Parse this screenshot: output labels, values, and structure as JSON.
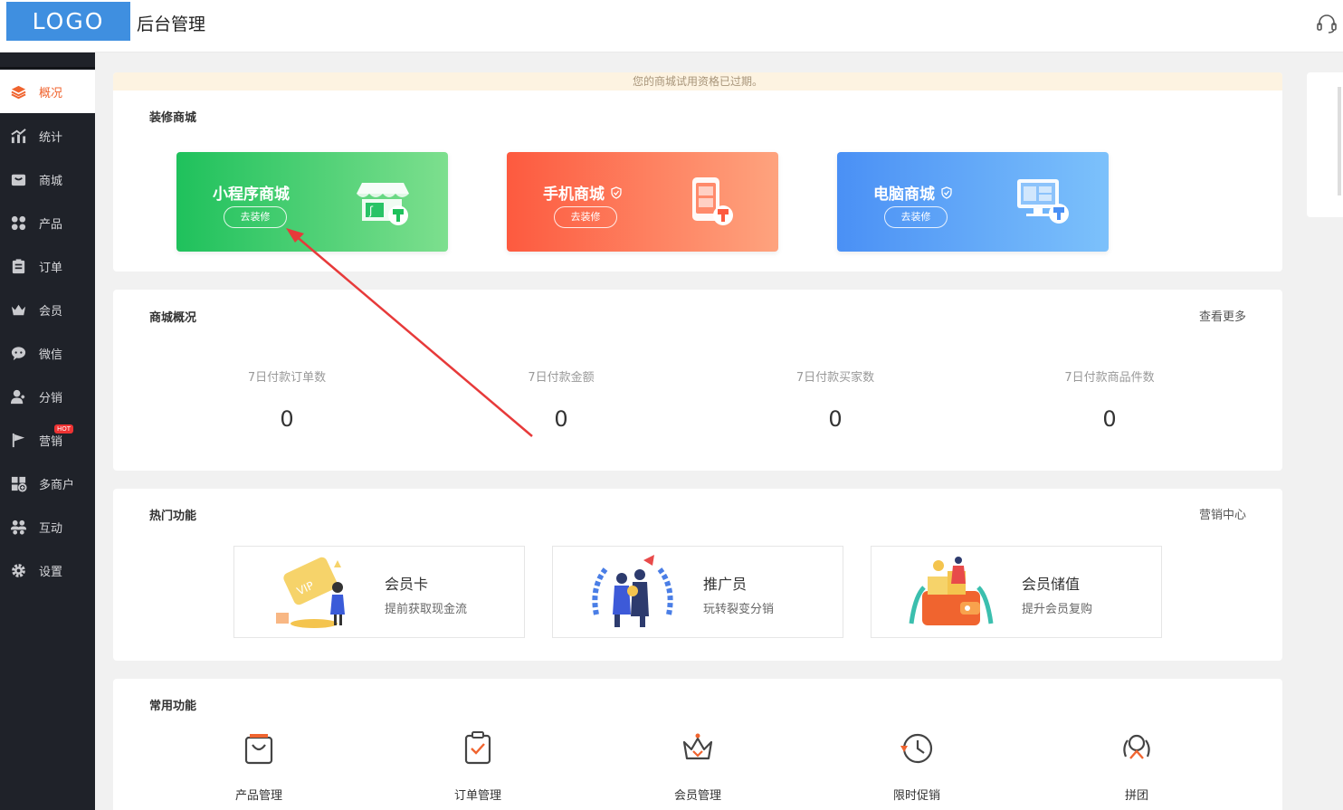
{
  "header": {
    "logo": "LOGO",
    "title": "后台管理"
  },
  "sidebar": {
    "items": [
      {
        "label": "概况",
        "icon": "layers-icon"
      },
      {
        "label": "统计",
        "icon": "chart-icon"
      },
      {
        "label": "商城",
        "icon": "store-icon"
      },
      {
        "label": "产品",
        "icon": "grid-icon"
      },
      {
        "label": "订单",
        "icon": "order-icon"
      },
      {
        "label": "会员",
        "icon": "crown-icon"
      },
      {
        "label": "微信",
        "icon": "wechat-icon"
      },
      {
        "label": "分销",
        "icon": "users-icon"
      },
      {
        "label": "营销",
        "icon": "flag-icon",
        "badge": "HOT"
      },
      {
        "label": "多商户",
        "icon": "multi-store-icon"
      },
      {
        "label": "互动",
        "icon": "interact-icon"
      },
      {
        "label": "设置",
        "icon": "gear-icon"
      }
    ]
  },
  "notice": "您的商城试用资格已过期。",
  "decorate": {
    "title": "装修商城",
    "cards": [
      {
        "name": "小程序商城",
        "button": "去装修",
        "color_from": "#1fc15c",
        "color_to": "#7ddf8e"
      },
      {
        "name": "手机商城",
        "button": "去装修",
        "color_from": "#fd5a3f",
        "color_to": "#fea37e"
      },
      {
        "name": "电脑商城",
        "button": "去装修",
        "color_from": "#4a90f5",
        "color_to": "#7cc1fb"
      }
    ]
  },
  "overview": {
    "title": "商城概况",
    "link": "查看更多",
    "stats": [
      {
        "label": "7日付款订单数",
        "value": "0"
      },
      {
        "label": "7日付款金额",
        "value": "0"
      },
      {
        "label": "7日付款买家数",
        "value": "0"
      },
      {
        "label": "7日付款商品件数",
        "value": "0"
      }
    ]
  },
  "hot": {
    "title": "热门功能",
    "link": "营销中心",
    "cards": [
      {
        "title": "会员卡",
        "subtitle": "提前获取现金流"
      },
      {
        "title": "推广员",
        "subtitle": "玩转裂变分销"
      },
      {
        "title": "会员储值",
        "subtitle": "提升会员复购"
      }
    ]
  },
  "common": {
    "title": "常用功能",
    "tools": [
      {
        "label": "产品管理",
        "icon": "bag-icon"
      },
      {
        "label": "订单管理",
        "icon": "clipboard-icon"
      },
      {
        "label": "会员管理",
        "icon": "crown-icon"
      },
      {
        "label": "限时促销",
        "icon": "clock-icon"
      },
      {
        "label": "拼团",
        "icon": "group-icon"
      }
    ]
  },
  "colors": {
    "accent": "#f0642f",
    "sidebar": "#1f2229",
    "logo": "#3f8fe0"
  }
}
